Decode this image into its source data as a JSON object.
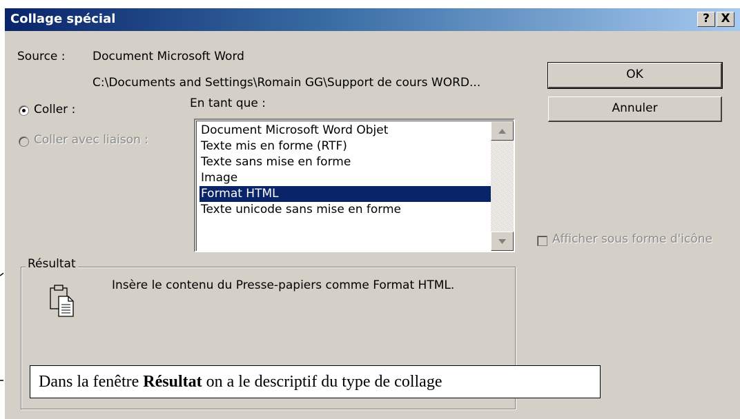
{
  "window": {
    "title": "Collage spécial",
    "help_label": "?",
    "close_label": "X"
  },
  "source": {
    "label": "Source :",
    "name": "Document Microsoft Word",
    "path": "C:\\Documents and Settings\\Romain GG\\Support de cours WORD..."
  },
  "options": {
    "paste_label": "Coller :",
    "paste_link_label": "Coller avec liaison :"
  },
  "as": {
    "label": "En tant que :",
    "items": [
      "Document Microsoft Word Objet",
      "Texte mis en forme (RTF)",
      "Texte sans mise en forme",
      "Image",
      "Format HTML",
      "Texte unicode sans mise en forme"
    ],
    "selected_index": 4
  },
  "buttons": {
    "ok": "OK",
    "cancel": "Annuler"
  },
  "display_icon": {
    "label": "Afficher sous forme d'icône",
    "checked": false
  },
  "result": {
    "label": "Résultat",
    "text": "Insère le contenu du Presse-papiers comme Format HTML."
  },
  "callout": {
    "prefix": "Dans la fenêtre ",
    "bold": "Résultat",
    "suffix": " on a le descriptif du type de collage"
  }
}
